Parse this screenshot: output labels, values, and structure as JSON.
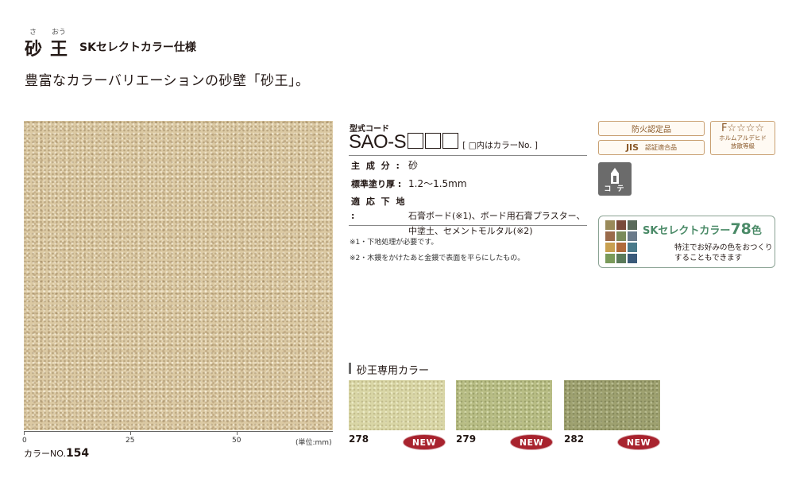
{
  "header": {
    "ruby_sa": "さ",
    "ruby_ou": "おう",
    "title_sa": "砂",
    "title_ou": "王",
    "subtitle": "SKセレクトカラー仕様",
    "tagline": "豊富なカラーバリエーションの砂壁「砂王」。"
  },
  "sample": {
    "scale_ticks": [
      "0",
      "25",
      "50"
    ],
    "scale_unit": "(単位:mm)",
    "color_label": "カラーNO.",
    "color_number": "154",
    "texture_color": "#dbc9a3"
  },
  "spec": {
    "code_label": "型式コード",
    "model": "SAO-S",
    "model_note": "[ □内はカラーNo. ]",
    "rows": [
      {
        "key": "主 成 分 :",
        "value": "砂"
      },
      {
        "key": "標準塗り厚 :",
        "value": "1.2〜1.5mm"
      },
      {
        "key": "適 応 下 地 :",
        "value": "石膏ボード(※1)、ボード用石膏プラスター、"
      },
      {
        "key": "",
        "value": "中塗土、セメントモルタル(※2)"
      }
    ],
    "footnotes": [
      "※1・下地処理が必要です。",
      "※2・木鏝をかけたあと金鏝で表面を平らにしたもの。"
    ]
  },
  "badges": {
    "fire": "防火認定品",
    "jis": "JIS",
    "jis_small": "認証適合品",
    "f_rating": "F☆☆☆☆",
    "f_line1": "ホルムアルデヒド",
    "f_line2": "放散等級",
    "kote": "コ テ"
  },
  "select": {
    "title": "SKセレクトカラー",
    "count": "78",
    "count_suffix": "色",
    "desc_line1": "特注でお好みの色をおつくり",
    "desc_line2": "することもできます",
    "grid_colors": [
      "#9a8a5a",
      "#7a4a3a",
      "#5a6a5a",
      "#9a6a4a",
      "#7a8a5a",
      "#6a7a8a",
      "#c8a050",
      "#b06a3a",
      "#4a7a8a",
      "#7a9a5a",
      "#5a7a5a",
      "#3a5a7a"
    ]
  },
  "colors": {
    "heading": "砂王専用カラー",
    "items": [
      {
        "number": "278",
        "badge": "NEW",
        "color": "#d9d6a6"
      },
      {
        "number": "279",
        "badge": "NEW",
        "color": "#b8bd85"
      },
      {
        "number": "282",
        "badge": "NEW",
        "color": "#9ea170"
      }
    ]
  }
}
